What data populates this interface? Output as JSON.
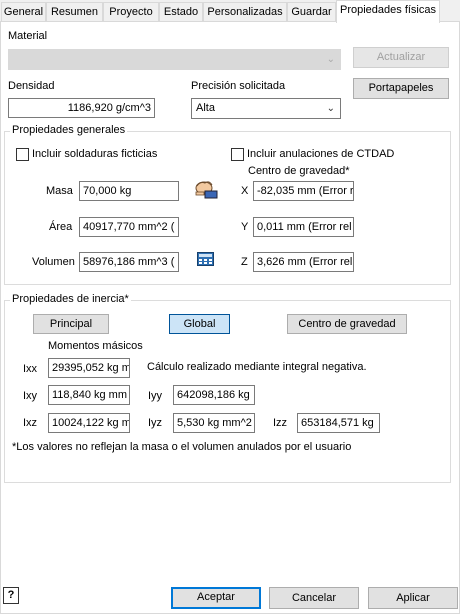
{
  "tabs": [
    {
      "label": "General"
    },
    {
      "label": "Resumen"
    },
    {
      "label": "Proyecto"
    },
    {
      "label": "Estado"
    },
    {
      "label": "Personalizadas"
    },
    {
      "label": "Guardar"
    },
    {
      "label": "Propiedades físicas"
    }
  ],
  "active_tab": "Propiedades físicas",
  "material": {
    "label": "Material",
    "value": "",
    "update_button": "Actualizar"
  },
  "density": {
    "label": "Densidad",
    "value": "1186,920 g/cm^3"
  },
  "precision": {
    "label": "Precisión solicitada",
    "value": "Alta"
  },
  "clipboard_button": "Portapapeles",
  "general": {
    "title": "Propiedades generales",
    "include_welds": "Incluir soldaduras ficticias",
    "include_overrides": "Incluir anulaciones de CTDAD",
    "cog_title": "Centro de gravedad*",
    "mass": {
      "label": "Masa",
      "value": "70,000 kg"
    },
    "area": {
      "label": "Área",
      "value": "40917,770 mm^2 ("
    },
    "volume": {
      "label": "Volumen",
      "value": "58976,186 mm^3 ("
    },
    "x": {
      "label": "X",
      "value": "-82,035 mm (Error r"
    },
    "y": {
      "label": "Y",
      "value": "0,011 mm (Error rel"
    },
    "z": {
      "label": "Z",
      "value": "3,626 mm (Error rel"
    }
  },
  "inertia": {
    "title": "Propiedades de inercia*",
    "btn_principal": "Principal",
    "btn_global": "Global",
    "btn_cog": "Centro de gravedad",
    "moments_label": "Momentos másicos",
    "calc_note": "Cálculo realizado mediante integral negativa.",
    "ixx": {
      "label": "Ixx",
      "value": "29395,052 kg m"
    },
    "ixy": {
      "label": "Ixy",
      "value": "118,840 kg mm"
    },
    "iyy": {
      "label": "Iyy",
      "value": "642098,186 kg"
    },
    "ixz": {
      "label": "Ixz",
      "value": "10024,122 kg m"
    },
    "iyz": {
      "label": "Iyz",
      "value": "5,530 kg mm^2"
    },
    "izz": {
      "label": "Izz",
      "value": "653184,571 kg"
    },
    "footnote": "*Los valores no reflejan la masa o el volumen anulados por el usuario"
  },
  "footer": {
    "help": "?",
    "accept": "Aceptar",
    "cancel": "Cancelar",
    "apply": "Aplicar"
  }
}
